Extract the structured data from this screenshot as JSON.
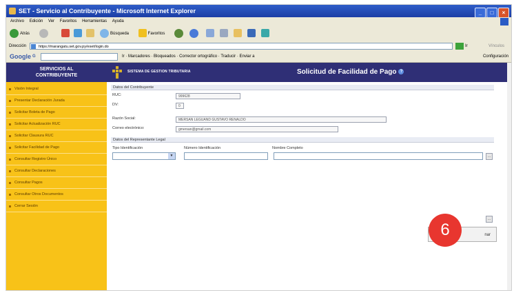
{
  "window": {
    "title": "SET - Servicio al Contribuyente - Microsoft Internet Explorer",
    "buttons": [
      "_",
      "□",
      "×"
    ]
  },
  "menu": [
    "Archivo",
    "Edición",
    "Ver",
    "Favoritos",
    "Herramientas",
    "Ayuda"
  ],
  "toolbar": {
    "back": "Atrás",
    "search": "Búsqueda",
    "favorites": "Favoritos"
  },
  "address": {
    "label": "Dirección",
    "url": "https://marangatu.set.gov.py/eset/login.do",
    "go": "Ir",
    "links": "Vínculos"
  },
  "google_bar": {
    "logo": "Google",
    "g": "G",
    "items": [
      "Ir",
      "Marcadores",
      "Bloqueados",
      "Corrector ortográfico",
      "Traducir",
      "Enviar a"
    ],
    "config": "Configuración"
  },
  "app": {
    "brand_line1": "SERVICIOS AL",
    "brand_line2": "CONTRIBUYENTE",
    "system_name": "SISTEMA DE GESTION TRIBUTARIA",
    "page_title": "Solicitud de Facilidad de Pago"
  },
  "sidebar": {
    "items": [
      "Visión Integral",
      "Presentar Declaración Jurada",
      "Solicitar Boleta de Pago",
      "Solicitar Actualización RUC",
      "Solicitar Clausura RUC",
      "Solicitar Facilidad de Pago",
      "Consultar Registro Único",
      "Consultar Declaraciones",
      "Consultar Pagos",
      "Consultar Otros Documentos",
      "Cerrar Sesión"
    ]
  },
  "form": {
    "section_contribuyente": "Datos del Contribuyente",
    "ruc_label": "RUC:",
    "ruc_value": "999628",
    "dv_label": "DV:",
    "dv_value": "0",
    "razon_label": "Razón Social:",
    "razon_value": "MERSAN LEGUAND GUSTAVO RENALDO",
    "correo_label": "Correo electrónico:",
    "correo_value": "gmersan@gmail.com",
    "section_representante": "Datos del Representante Legal",
    "tipo_label": "Tipo Identificación",
    "numero_label": "Número Identificación",
    "nombre_label": "Nombre Completo",
    "button_label": "nar"
  },
  "callout": "6"
}
